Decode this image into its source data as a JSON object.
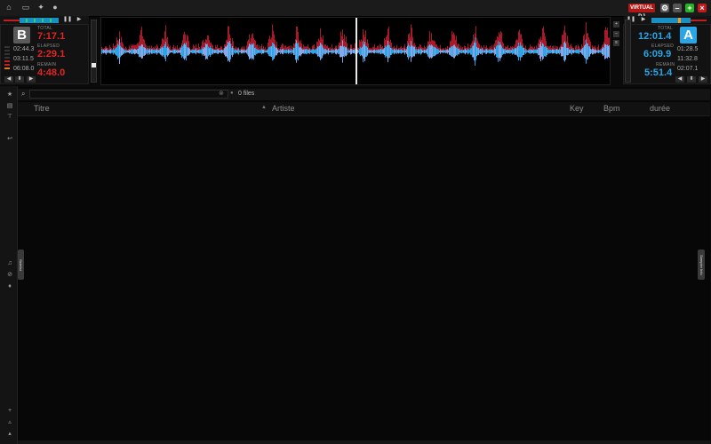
{
  "app": {
    "logo_text": "VIRTUAL DJ",
    "top_icons": [
      "folder-icon",
      "monitor-icon",
      "network-icon",
      "record-icon"
    ],
    "window_buttons": [
      "settings-icon",
      "minimize-icon",
      "maximize-icon",
      "close-icon"
    ]
  },
  "deck_left": {
    "letter": "B",
    "total_label": "TOTAL",
    "total": "7:17.1",
    "elapsed_label": "ELAPSED",
    "elapsed": "2:29.1",
    "remain_label": "REMAIN",
    "remain": "4:48.0",
    "cue_times": [
      "02:44.3",
      "03:11.5",
      "06:08.0"
    ],
    "accent": "#e22525"
  },
  "deck_right": {
    "letter": "A",
    "total_label": "TOTAL",
    "total": "12:01.4",
    "elapsed_label": "ELAPSED",
    "elapsed": "6:09.9",
    "remain_label": "REMAIN",
    "remain": "5:51.4",
    "cue_times": [
      "01:28.5",
      "11:32.8",
      "02:07.1"
    ],
    "accent": "#2aa6e6"
  },
  "browser": {
    "search_value": "",
    "file_count": "0 files",
    "columns": [
      "Titre",
      "Artiste",
      "Key",
      "Bpm",
      "durée"
    ],
    "sort_column": "Artiste",
    "rows": [],
    "left_tab": "Sidelist",
    "right_tab": "Sampler Info"
  }
}
